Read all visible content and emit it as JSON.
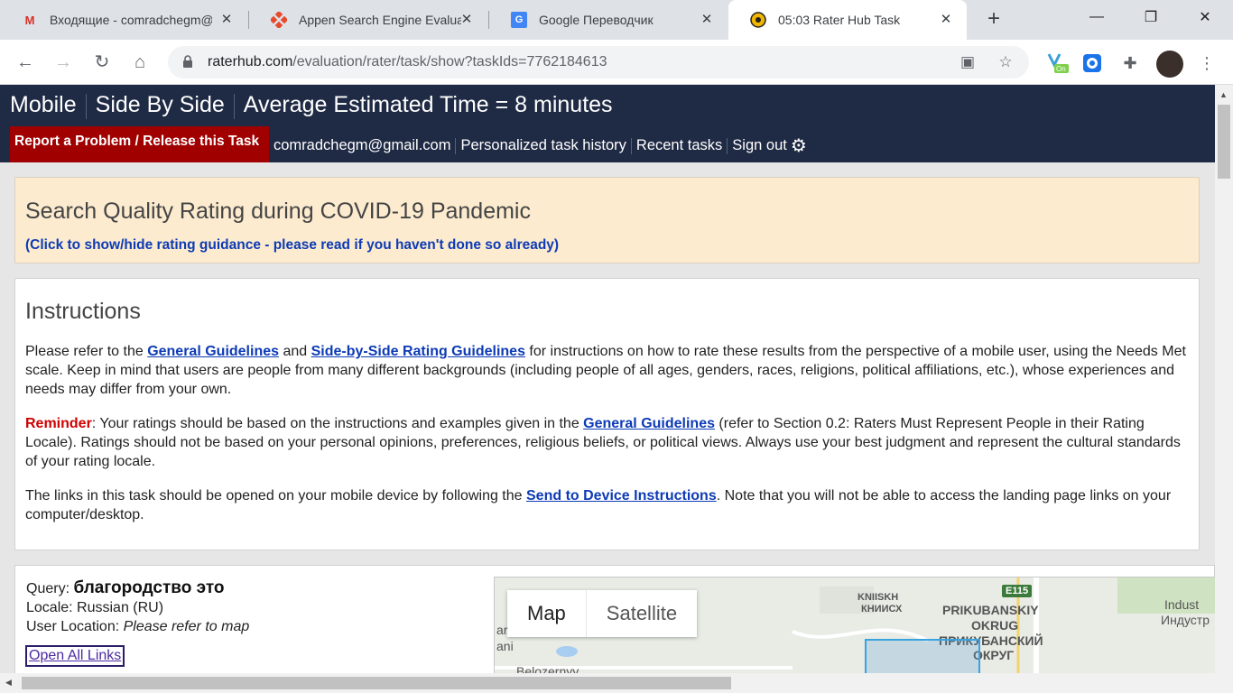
{
  "browser": {
    "tabs": [
      {
        "title": "Входящие - comradchegm@",
        "icon": "gmail-icon"
      },
      {
        "title": "Appen Search Engine Evalua",
        "icon": "appen-icon"
      },
      {
        "title": "Google Переводчик",
        "icon": "google-translate-icon"
      },
      {
        "title": "05:03 Rater Hub Task",
        "icon": "raterhub-icon",
        "active": true
      }
    ],
    "close_glyph": "✕",
    "new_tab_glyph": "+",
    "url_host": "raterhub.com",
    "url_path": "/evaluation/rater/task/show?taskIds=7762184613",
    "window_controls": {
      "minimize": "—",
      "maximize": "❐",
      "close": "✕"
    }
  },
  "header": {
    "title_parts": [
      "Mobile",
      "Side By Side",
      "Average Estimated Time = 8 minutes"
    ],
    "report_label": "Report a Problem / Release this Task",
    "nav_links": [
      "comradchegm@gmail.com",
      "Personalized task history",
      "Recent tasks",
      "Sign out"
    ],
    "bg_color": "#1f2a44",
    "report_color": "#a00000"
  },
  "banner": {
    "title": "Search Quality Rating during COVID-19 Pandemic",
    "toggle_link": "(Click to show/hide rating guidance - please read if you haven't done so already)"
  },
  "instructions": {
    "heading": "Instructions",
    "p1_pre": "Please refer to the ",
    "p1_link1": "General Guidelines",
    "p1_mid": " and ",
    "p1_link2": "Side-by-Side Rating Guidelines",
    "p1_post": " for instructions on how to rate these results from the perspective of a mobile user, using the Needs Met scale. Keep in mind that users are people from many different backgrounds (including people of all ages, genders, races, religions, political affiliations, etc.), whose experiences and needs may differ from your own.",
    "p2_label": "Reminder",
    "p2_pre": ": Your ratings should be based on the instructions and examples given in the ",
    "p2_link": "General Guidelines",
    "p2_post": " (refer to Section 0.2: Raters Must Represent People in their Rating Locale). Ratings should not be based on your personal opinions, preferences, religious beliefs, or political views. Always use your best judgment and represent the cultural standards of your rating locale.",
    "p3_pre": "The links in this task should be opened on your mobile device by following the ",
    "p3_link": "Send to Device Instructions",
    "p3_post": ". Note that you will not be able to access the landing page links on your computer/desktop."
  },
  "query": {
    "query_label": "Query: ",
    "query_text": "благородство это",
    "locale_label": "Locale: ",
    "locale_value": "Russian (RU)",
    "location_label": "User Location: ",
    "location_value": "Please refer to map",
    "open_all": "Open All Links"
  },
  "map": {
    "map_button": "Map",
    "satellite_button": "Satellite",
    "road_badge": "E115",
    "labels": [
      "KNIISKH",
      "КНИИСХ",
      "PRIKUBANSKIY",
      "OKRUG",
      "ПРИКУБАНСКИЙ",
      "ОКРУГ",
      "Indust",
      "Индустр",
      "ani",
      "Belozernyy",
      "ar"
    ]
  }
}
